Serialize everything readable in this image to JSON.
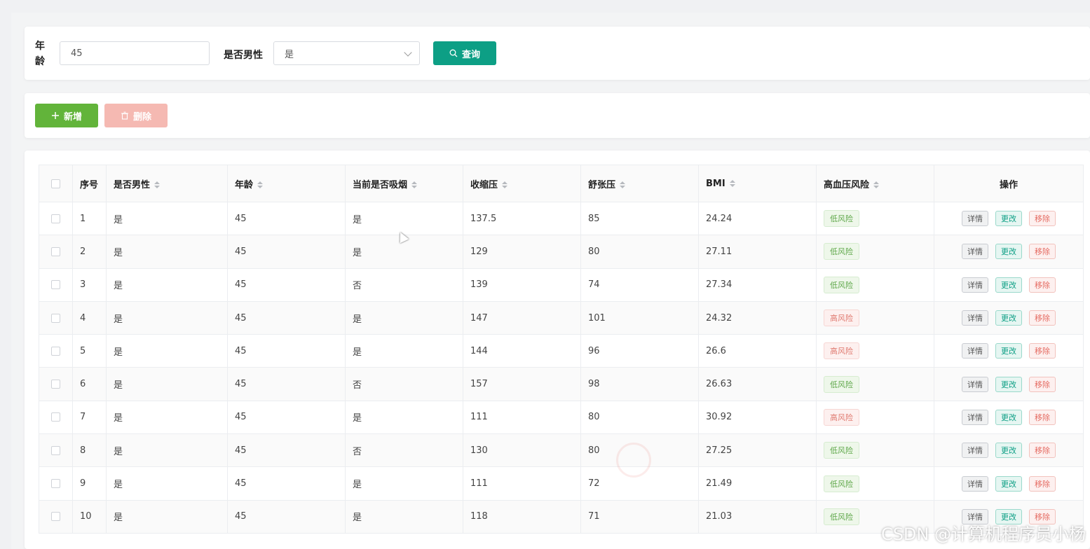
{
  "search": {
    "age_label": "年龄",
    "age_value": "45",
    "male_label": "是否男性",
    "male_value": "是",
    "query_label": "查询"
  },
  "toolbar": {
    "add_label": "新增",
    "delete_label": "删除"
  },
  "table": {
    "headers": [
      "序号",
      "是否男性",
      "年龄",
      "当前是否吸烟",
      "收缩压",
      "舒张压",
      "BMI",
      "高血压风险",
      "操作"
    ],
    "actions": {
      "detail": "详情",
      "edit": "更改",
      "remove": "移除"
    },
    "rows": [
      {
        "no": "1",
        "male": "是",
        "age": "45",
        "smoker": "是",
        "sys": "137.5",
        "dia": "85",
        "bmi": "24.24",
        "risk": "低风险",
        "risk_level": "low"
      },
      {
        "no": "2",
        "male": "是",
        "age": "45",
        "smoker": "是",
        "sys": "129",
        "dia": "80",
        "bmi": "27.11",
        "risk": "低风险",
        "risk_level": "low"
      },
      {
        "no": "3",
        "male": "是",
        "age": "45",
        "smoker": "否",
        "sys": "139",
        "dia": "74",
        "bmi": "27.34",
        "risk": "低风险",
        "risk_level": "low"
      },
      {
        "no": "4",
        "male": "是",
        "age": "45",
        "smoker": "是",
        "sys": "147",
        "dia": "101",
        "bmi": "24.32",
        "risk": "高风险",
        "risk_level": "high"
      },
      {
        "no": "5",
        "male": "是",
        "age": "45",
        "smoker": "是",
        "sys": "144",
        "dia": "96",
        "bmi": "26.6",
        "risk": "高风险",
        "risk_level": "high"
      },
      {
        "no": "6",
        "male": "是",
        "age": "45",
        "smoker": "否",
        "sys": "157",
        "dia": "98",
        "bmi": "26.63",
        "risk": "低风险",
        "risk_level": "low"
      },
      {
        "no": "7",
        "male": "是",
        "age": "45",
        "smoker": "是",
        "sys": "111",
        "dia": "80",
        "bmi": "30.92",
        "risk": "高风险",
        "risk_level": "high"
      },
      {
        "no": "8",
        "male": "是",
        "age": "45",
        "smoker": "否",
        "sys": "130",
        "dia": "80",
        "bmi": "27.25",
        "risk": "低风险",
        "risk_level": "low"
      },
      {
        "no": "9",
        "male": "是",
        "age": "45",
        "smoker": "是",
        "sys": "111",
        "dia": "72",
        "bmi": "21.49",
        "risk": "低风险",
        "risk_level": "low"
      },
      {
        "no": "10",
        "male": "是",
        "age": "45",
        "smoker": "是",
        "sys": "118",
        "dia": "71",
        "bmi": "21.03",
        "risk": "低风险",
        "risk_level": "low"
      }
    ]
  },
  "watermark": "CSDN @计算机程序员小杨",
  "colors": {
    "primary": "#0d9f85",
    "add": "#62b43a",
    "delete_disabled": "#f5b9b2",
    "low_risk": "#5fa84a",
    "high_risk": "#e07a70"
  }
}
